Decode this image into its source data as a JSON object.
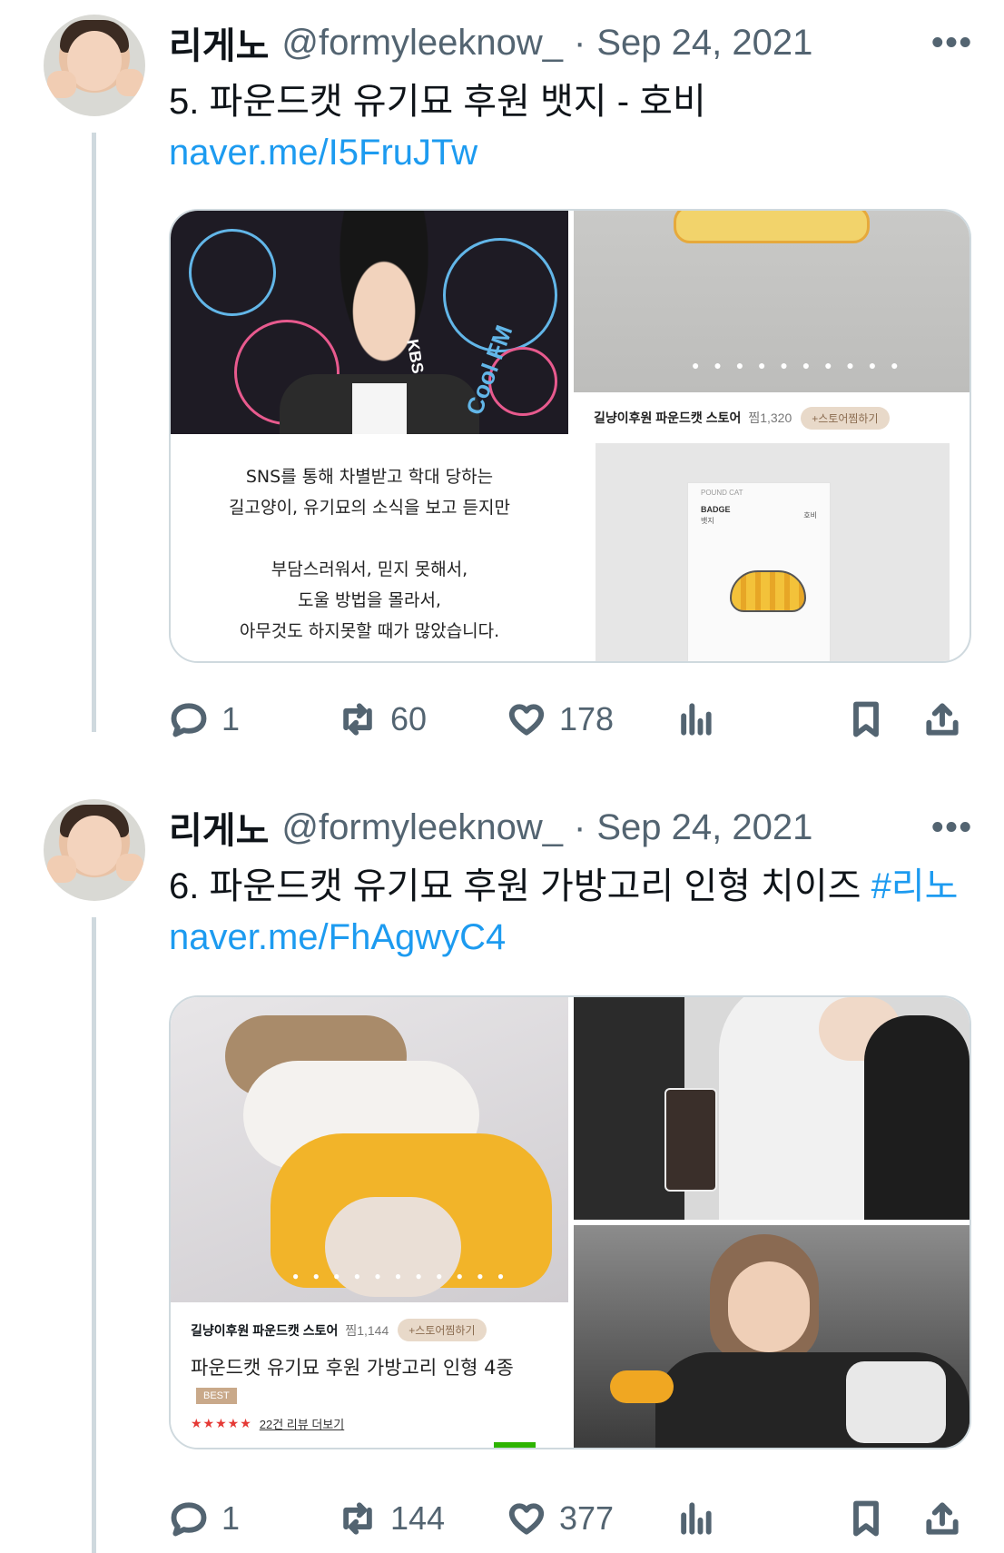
{
  "tweets": [
    {
      "author_name": "리게노",
      "handle": "@formyleeknow_",
      "separator": "·",
      "date": "Sep 24, 2021",
      "more_label": "•••",
      "text": "5. 파운드캣 유기묘 후원 뱃지 - 호비",
      "link": "naver.me/I5FruJTw",
      "media": {
        "left_caption_lines": [
          "SNS를 통해 차별받고 학대 당하는",
          "길고양이, 유기묘의 소식을 보고 듣지만",
          "",
          "부담스러워서, 믿지 못해서,",
          "도울 방법을 몰라서,",
          "아무것도 하지못할 때가 많았습니다."
        ],
        "poster_text": [
          "Cool FM",
          "KBS"
        ],
        "store_name": "길냥이후원 파운드캣 스토어",
        "store_likes": "찜1,320",
        "store_button": "+스토어찜하기",
        "badge_brand": "POUND CAT",
        "badge_title": "BADGE",
        "badge_sub": "뱃지",
        "badge_right": "호비"
      },
      "stats": {
        "replies": "1",
        "retweets": "60",
        "likes": "178"
      }
    },
    {
      "author_name": "리게노",
      "handle": "@formyleeknow_",
      "separator": "·",
      "date": "Sep 24, 2021",
      "more_label": "•••",
      "text": "6. 파운드캣 유기묘 후원 가방고리 인형 치이즈 ",
      "hashtag": "#리노",
      "link": "naver.me/FhAgwyC4",
      "media": {
        "store_name": "길냥이후원 파운드캣 스토어",
        "store_likes": "찜1,144",
        "store_button": "+스토어찜하기",
        "product_title": "파운드캣 유기묘 후원 가방고리 인형 4종",
        "best_tag": "BEST",
        "stars": "★★★★★",
        "reviews": "22건 리뷰 더보기"
      },
      "stats": {
        "replies": "1",
        "retweets": "144",
        "likes": "377"
      }
    }
  ],
  "icons": {
    "reply": "reply-icon",
    "retweet": "retweet-icon",
    "like": "heart-icon",
    "views": "analytics-icon",
    "bookmark": "bookmark-icon",
    "share": "share-icon"
  },
  "colors": {
    "link": "#1d9bf0",
    "secondary": "#536471",
    "border": "#cfd9de"
  }
}
